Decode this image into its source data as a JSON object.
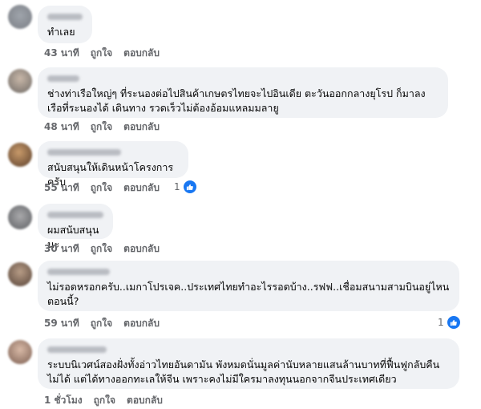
{
  "actions": {
    "like": "ถูกใจ",
    "reply": "ตอบกลับ"
  },
  "comments": [
    {
      "text": "ทำเลย",
      "time": "43 นาที"
    },
    {
      "text": "ช่างท่าเรือใหญ่ๆ ที่ระนองต่อไปสินค้าเกษตรไทยจะไปอินเดีย ตะวันออกกลางยุโรป ก็มาลงเรือที่ระนองได้ เดินทาง รวดเร็วไม่ต้องอ้อมแหลมมลายู",
      "time": "48 นาที"
    },
    {
      "text": "สนับสนุนให้เดินหน้าโครงการครับ",
      "time": "55 นาที",
      "reactions": "1"
    },
    {
      "text": "ผมสนับสนุนนะ",
      "time": "30 นาที"
    },
    {
      "text": "ไม่รอดหรอกครับ..เมกาโปรเจค..ประเทศไทยทำอะไรรอดบ้าง..รฟฟ..เชื่อมสนามสามบินอยู่ไหนตอนนี้?",
      "time": "59 นาที",
      "reactions": "1"
    },
    {
      "text": "ระบบนิเวศน์สองฝั่งทั้งอ่าวไทยอันดามัน พังหมดนั่นมูลค่านับหลายแสนล้านบาทที่ฟื้นฟูกลับคืนไม่ได้ แต่ได้ทางออกทะเลให้จีน เพราะคงไม่มีใครมาลงทุนนอกจากจีนประเทศเดียว",
      "time": "1 ชั่วโมง"
    }
  ],
  "icons": {
    "like": "thumbs-up-icon"
  },
  "colors": {
    "bubble": "#f0f2f5",
    "meta": "#65676b",
    "like": "#1877f2"
  }
}
